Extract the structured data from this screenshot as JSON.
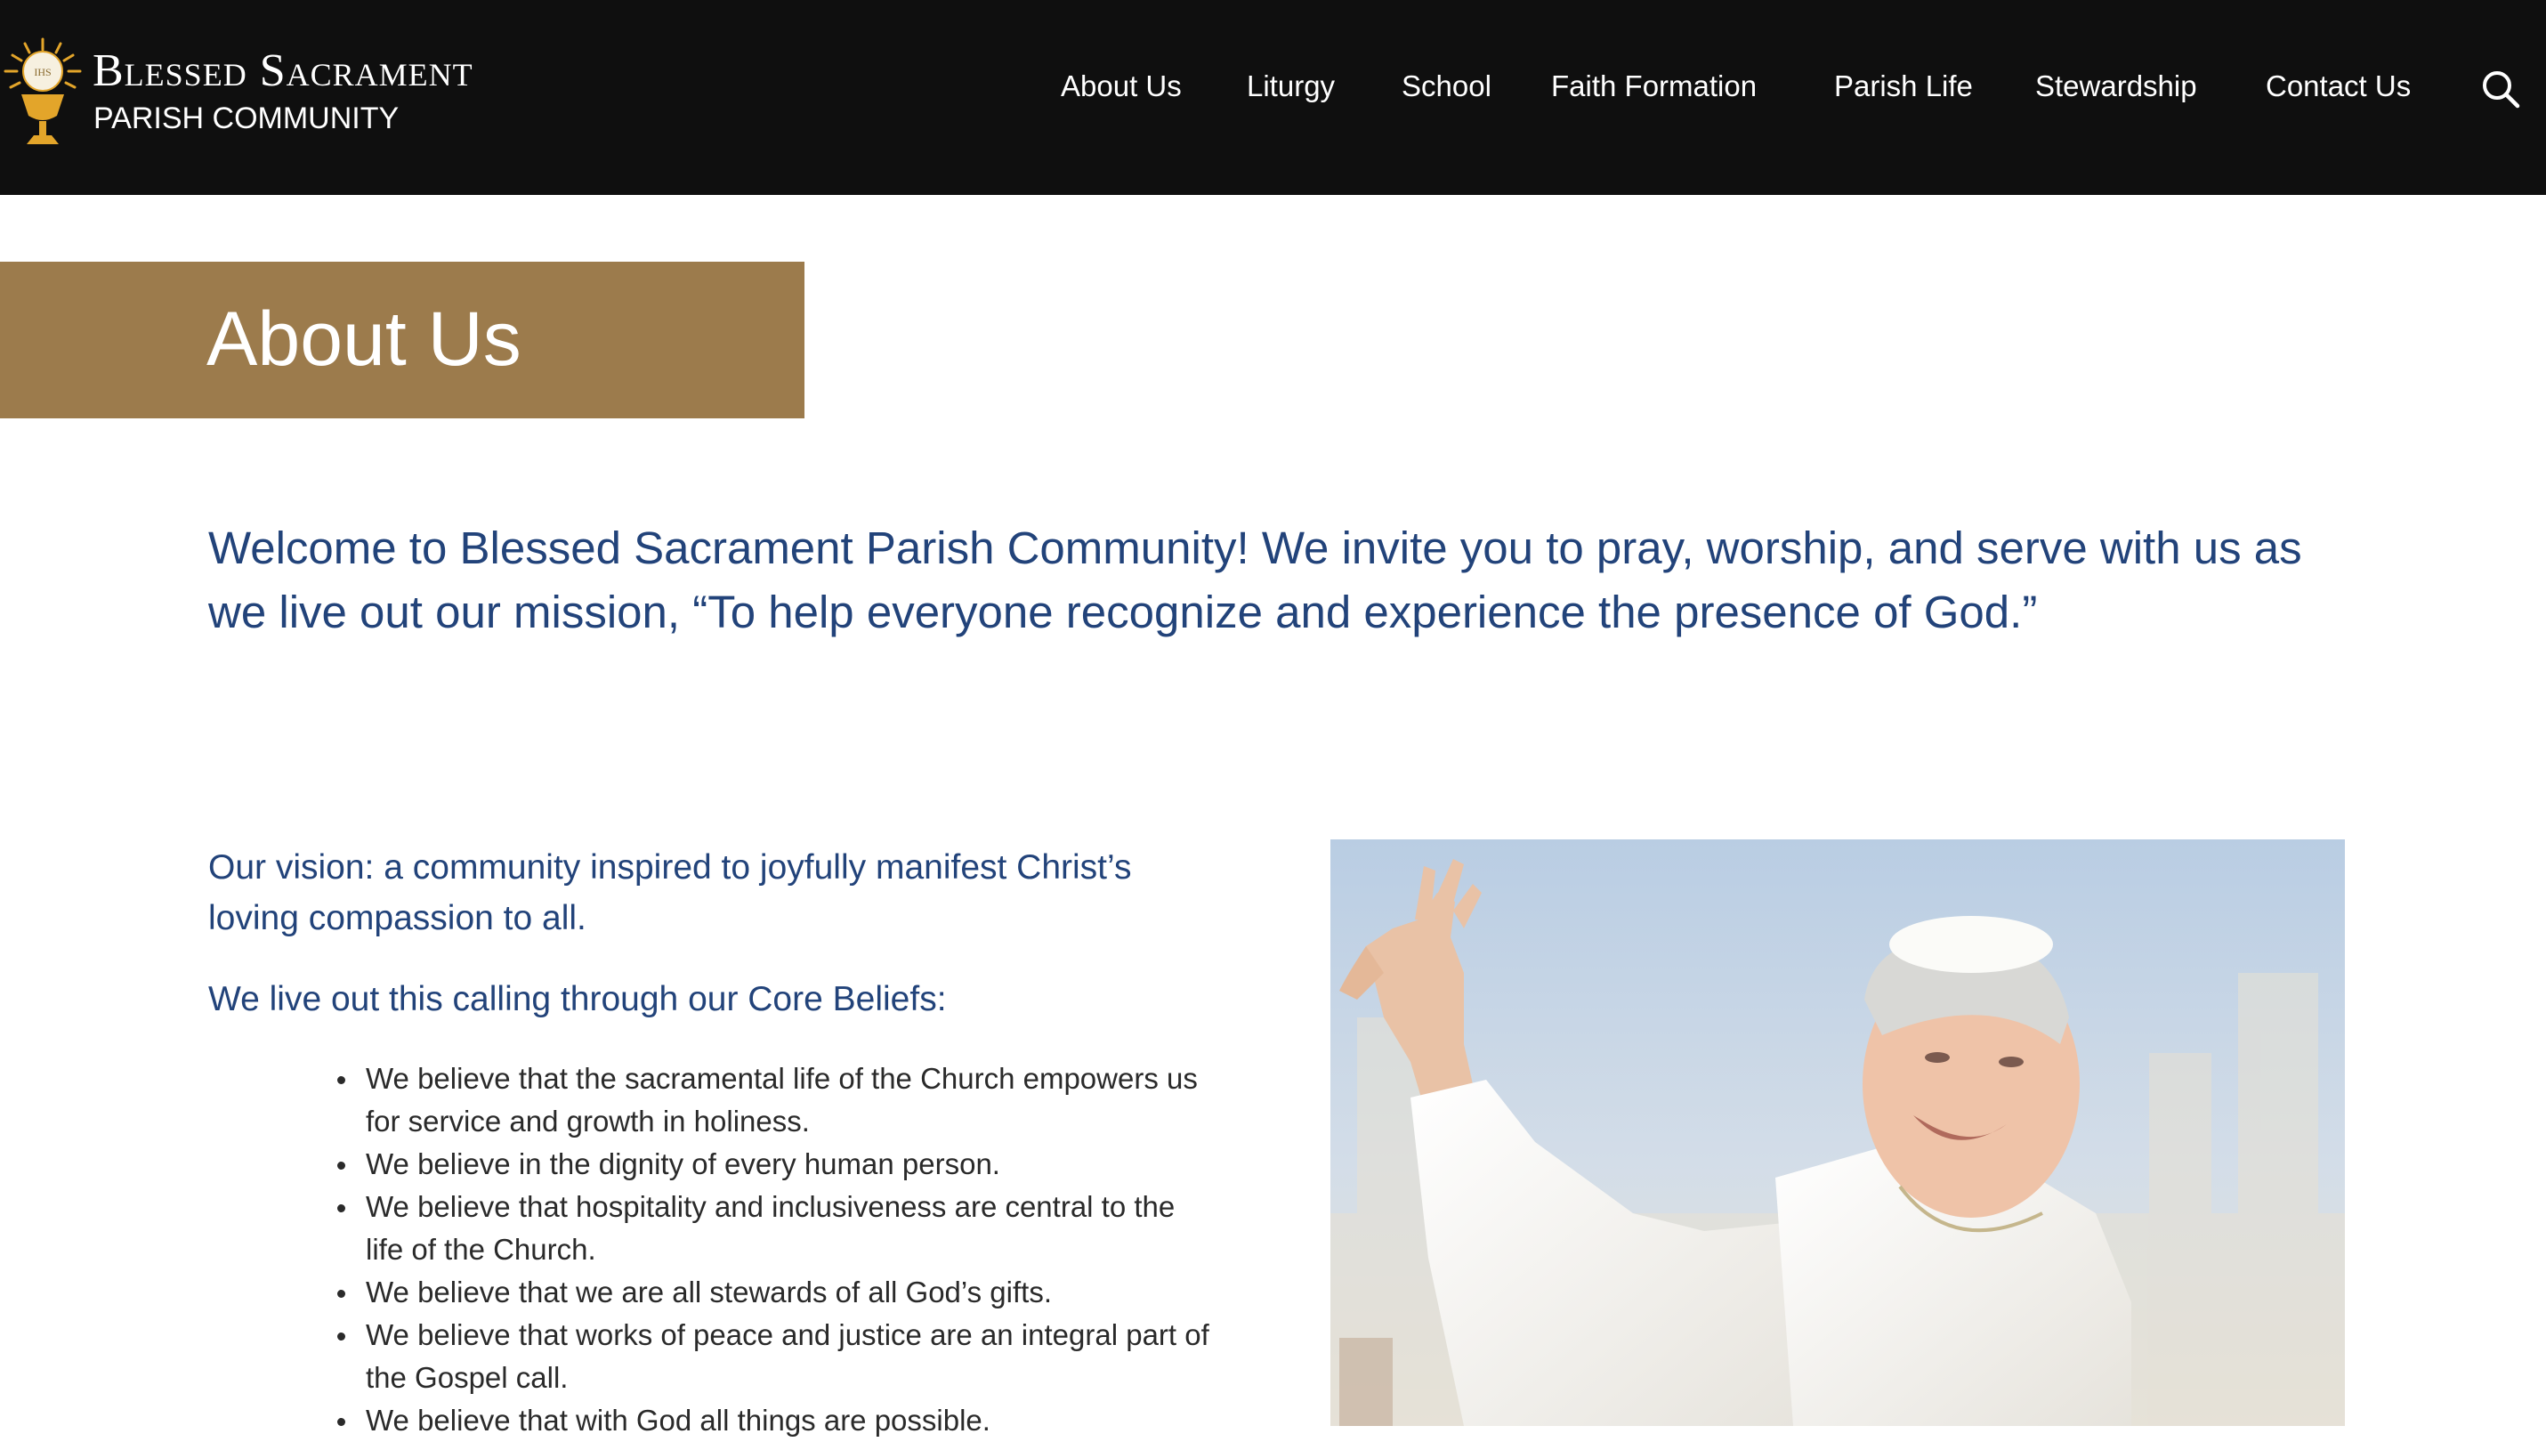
{
  "header": {
    "logo_title": "Blessed Sacrament",
    "logo_subtitle": "PARISH COMMUNITY",
    "logo_badge": "IHS",
    "nav": [
      {
        "label": "About Us"
      },
      {
        "label": "Liturgy"
      },
      {
        "label": "School"
      },
      {
        "label": "Faith Formation"
      },
      {
        "label": "Parish Life"
      },
      {
        "label": "Stewardship"
      },
      {
        "label": "Contact Us"
      }
    ],
    "search_icon": "search-icon"
  },
  "banner": {
    "title": "About Us"
  },
  "intro": "Welcome to Blessed Sacrament Parish Community! We invite you to pray, worship, and serve with us as we live out our mission, “To help everyone recognize and experience the presence of God.”",
  "content": {
    "vision": "Our vision: a community inspired to joyfully manifest Christ’s loving compassion to all.",
    "calling": "We live out this calling through our Core Beliefs:",
    "beliefs": [
      "We believe that the sacramental life of the Church empowers us for service and growth in holiness.",
      "We believe in the dignity of every human person.",
      "We believe that hospitality and inclusiveness are central to the life of the Church.",
      "We believe that we are all stewards of all God’s gifts.",
      "We believe that works of peace and justice are an integral part of the Gospel call.",
      "We believe that with God all things are possible."
    ]
  },
  "colors": {
    "header_bg": "#0f0f0f",
    "banner_bg": "#9c7b4c",
    "accent_text": "#22437a",
    "logo_gold": "#e3a52a"
  }
}
